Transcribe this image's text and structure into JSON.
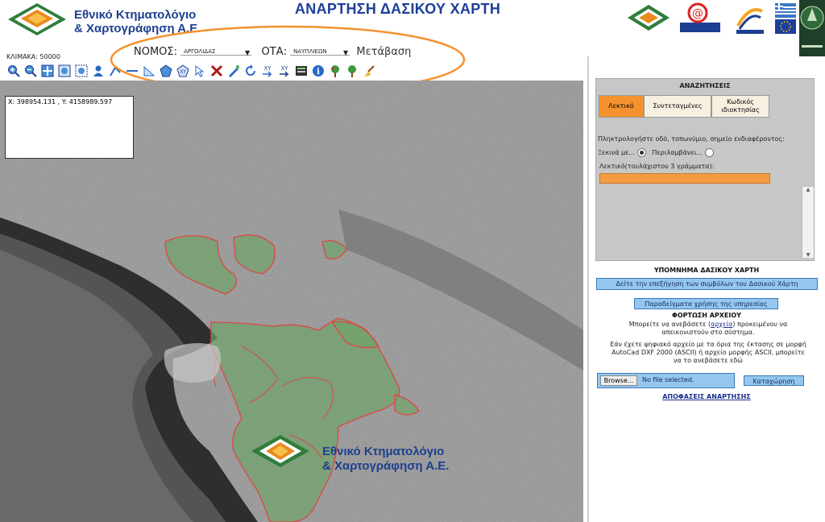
{
  "header": {
    "company_line1": "Εθνικό Κτηματολόγιο",
    "company_line2": "& Χαρτογράφηση Α.Ε.",
    "title": "ΑΝΑΡΤΗΣΗ ΔΑΣΙΚΟΥ ΧΑΡΤΗ",
    "partner_logos": [
      "ktimatologio-logo",
      "e-gov-logo",
      "ellada-2008-logo",
      "greece-eu-flags-logo",
      "ministry-logo"
    ]
  },
  "map_controls": {
    "scale": "ΚΛΙΜΑΚΑ: 50000",
    "nomos_label": "ΝΟΜΟΣ:",
    "nomos_value": "ΑΡΓΟΛΙΔΑΣ",
    "ota_label": "ΟΤΑ:",
    "ota_value": "ΝΑΥΠΛΙΕΩΝ",
    "go_label": "Μετάβαση"
  },
  "toolbar": {
    "icons": [
      "zoom-in-icon",
      "zoom-out-icon",
      "pan-icon",
      "zoom-extent-icon",
      "zoom-window-icon",
      "user-icon",
      "measure-icon",
      "line-icon",
      "area-measure-icon",
      "polygon-icon",
      "xy-icon",
      "select-icon",
      "clear-icon",
      "draw-icon",
      "refresh-icon",
      "xy-go-icon",
      "xy-export-icon",
      "map-info-icon",
      "info-icon",
      "tree-icon",
      "tree-alt-icon",
      "broom-icon"
    ]
  },
  "map": {
    "coords": "X: 398954.131 , Y: 4158989.597",
    "watermark_line1": "Εθνικό Κτηματολόγιο",
    "watermark_line2": "& Χαρτογράφηση Α.Ε."
  },
  "search": {
    "title": "ΑΝΑΖΗΤΗΣΕΙΣ",
    "tabs": [
      "Λεκτικό",
      "Συντεταγμένες",
      "Κωδικός ιδιοκτησίας"
    ],
    "prompt": "Πληκτρολογήστε οδό, τοπωνύμιο, σημείο ενδιαφέροντος:",
    "starts_with": "Ξεκινά με...",
    "contains": "Περιλαμβάνει...",
    "text_label": "Λεκτικό(τουλάχιστον 3 γράμματα):"
  },
  "legend": {
    "title": "ΥΠΟΜΝΗΜΑ ΔΑΣΙΚΟΥ ΧΑΡΤΗ",
    "explain_button": "Δείτε την επεξήγηση των συμβόλων του Δασικού Χάρτη",
    "examples_button": "Παραδείγματα χρήσης της υπηρεσίας"
  },
  "upload": {
    "title": "ΦΟΡΤΩΣΗ ΑΡΧΕΙΟΥ",
    "text1_pre": "Μπορείτε να ανεβάσετε (",
    "text1_link": "αρχεία",
    "text1_post": ") προκειμένου να",
    "text1_line2": "απεικονιστούν στο σύστημα.",
    "text2_line1": "Εάν έχετε ψηφιακό αρχείο με τα όρια της έκτασης σε μορφή",
    "text2_line2": "AutoCad DXF 2000 (ASCII) ή αρχείο μορφής ASCII, μπορείτε",
    "text2_line3": "να το ανεβάσετε εδώ",
    "browse": "Browse...",
    "no_file": "No file selected.",
    "register": "Καταχώρηση",
    "decisions": "ΑΠΟΦΑΣΕΙΣ ΑΝΑΡΤΗΣΗΣ"
  },
  "colors": {
    "accent_orange": "#f5922e",
    "brand_blue": "#1d3f8f",
    "forest_green": "#6fa36a"
  }
}
